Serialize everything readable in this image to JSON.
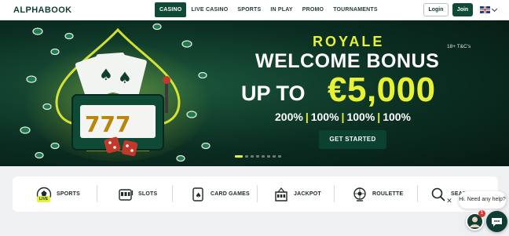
{
  "header": {
    "logo": "ALPHABOOK",
    "nav": [
      "CASINO",
      "LIVE CASINO",
      "SPORTS",
      "IN PLAY",
      "PROMO",
      "TOURNAMENTS"
    ],
    "active_nav": "CASINO",
    "login_label": "Login",
    "join_label": "Join",
    "language_icon": "uk-flag-icon"
  },
  "hero": {
    "tc": "18+ T&C's",
    "royale": "ROYALE",
    "welcome": "WELCOME BONUS",
    "upto": "UP TO",
    "amount": "€5,000",
    "percentages": [
      "200%",
      "100%",
      "100%",
      "100%"
    ],
    "cta_label": "GET STARTED",
    "slides_total": 8,
    "active_slide": 0
  },
  "categories": [
    {
      "label": "SPORTS",
      "icon": "football-icon",
      "badge": "LIVE"
    },
    {
      "label": "SLOTS",
      "icon": "slot-machine-icon"
    },
    {
      "label": "CARD GAMES",
      "icon": "playing-cards-icon"
    },
    {
      "label": "JACKPOT",
      "icon": "jackpot-icon"
    },
    {
      "label": "ROULETTE",
      "icon": "roulette-icon"
    },
    {
      "label": "SEARCH",
      "icon": "search-icon"
    }
  ],
  "chat": {
    "close_label": "✕",
    "prompt": "Hi. Need any help?",
    "badge_count": "1"
  },
  "colors": {
    "brand_green": "#0e4a36",
    "accent_yellow": "#e6f233",
    "hero_bg": "#0b2e22"
  }
}
